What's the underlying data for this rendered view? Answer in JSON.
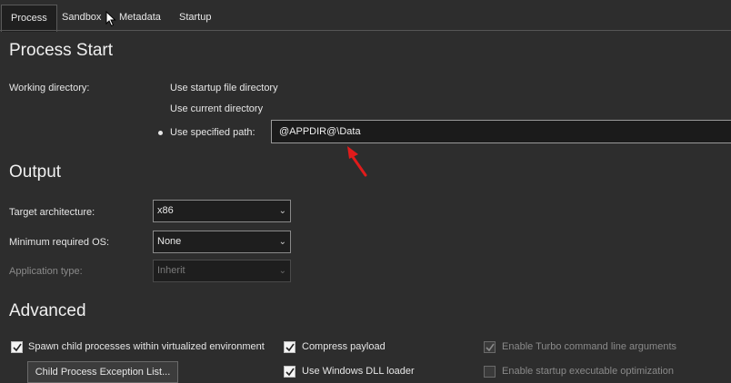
{
  "tabs": [
    "Process",
    "Sandbox",
    "Metadata",
    "Startup"
  ],
  "process_start": {
    "title": "Process Start",
    "working_dir_label": "Working directory:",
    "options": [
      "Use startup file directory",
      "Use current directory",
      "Use specified path:"
    ],
    "selected_option": "Use specified path:",
    "path_value": "@APPDIR@\\Data"
  },
  "output": {
    "title": "Output",
    "target_arch_label": "Target architecture:",
    "target_arch_value": "x86",
    "min_os_label": "Minimum required OS:",
    "min_os_value": "None",
    "app_type_label": "Application type:",
    "app_type_value": "Inherit"
  },
  "advanced": {
    "title": "Advanced",
    "spawn_label": "Spawn child processes within virtualized environment",
    "compress_label": "Compress payload",
    "dll_loader_label": "Use Windows DLL loader",
    "turbo_args_label": "Enable Turbo command line arguments",
    "startup_opt_label": "Enable startup executable optimization",
    "exception_button": "Child Process Exception List..."
  },
  "icons": {
    "cursor": "mouse-pointer-icon",
    "annotation": "red-arrow-icon",
    "check": "checkmark-icon",
    "dropdown": "chevron-down-icon"
  },
  "colors": {
    "background": "#2d2d2d",
    "annotation_arrow": "#e01b1b"
  }
}
